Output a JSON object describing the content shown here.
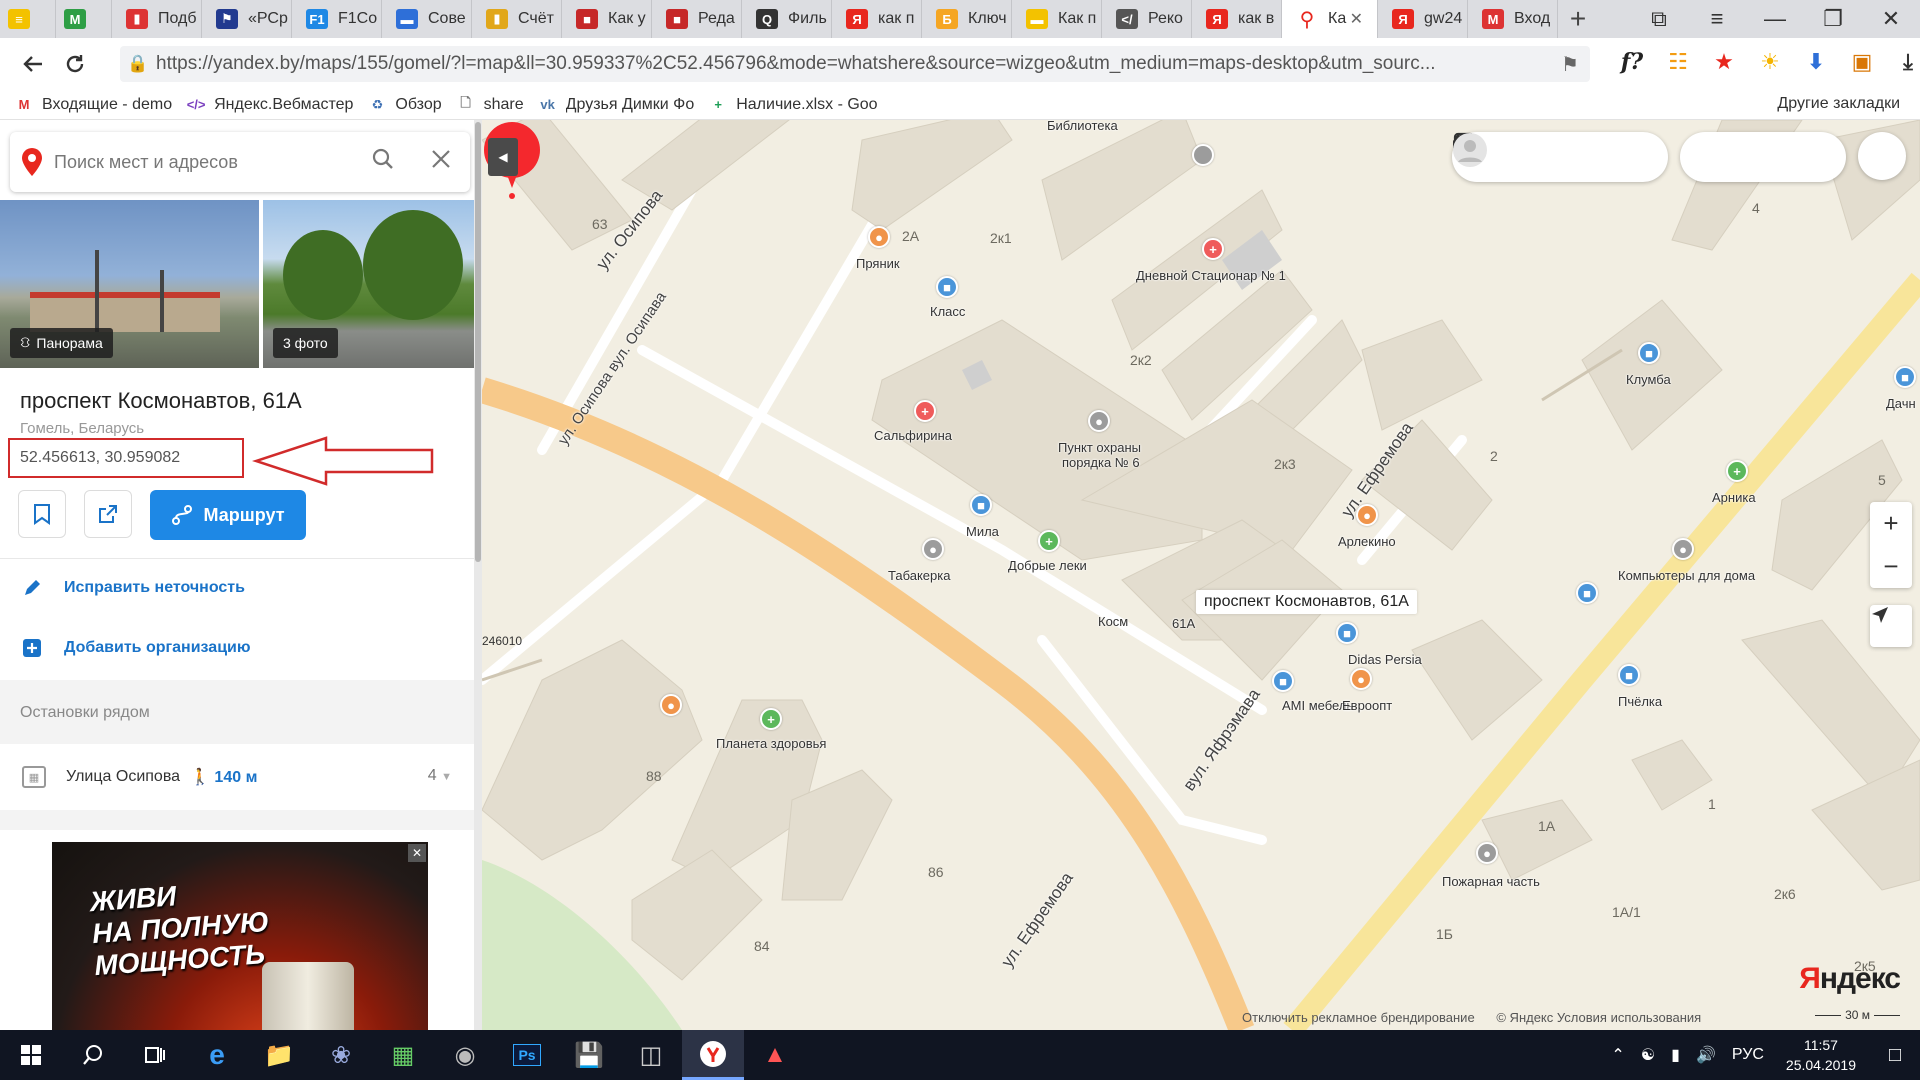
{
  "browser": {
    "tabs": [
      {
        "label": "",
        "icon": "yellow-doc",
        "color": "#f3c200"
      },
      {
        "label": "",
        "icon": "gmail",
        "color": "#2e9e45"
      },
      {
        "label": "Подб",
        "icon": "chart",
        "color": "#d33"
      },
      {
        "label": "«РСр",
        "icon": "flag",
        "color": "#223a8f"
      },
      {
        "label": "F1Co",
        "icon": "f1",
        "color": "#1e88e5"
      },
      {
        "label": "Сове",
        "icon": "disk",
        "color": "#2e6fd8"
      },
      {
        "label": "Счёт",
        "icon": "chart",
        "color": "#e1a71a"
      },
      {
        "label": "Как у",
        "icon": "book",
        "color": "#c62828"
      },
      {
        "label": "Реда",
        "icon": "book",
        "color": "#c62828"
      },
      {
        "label": "Филь",
        "icon": "search",
        "color": "#333"
      },
      {
        "label": "как п",
        "icon": "yandex",
        "color": "#e8271e"
      },
      {
        "label": "Ключ",
        "icon": "b",
        "color": "#f5a623"
      },
      {
        "label": "Как п",
        "icon": "beeline",
        "color": "#f3c200"
      },
      {
        "label": "Реко",
        "icon": "code",
        "color": "#555"
      },
      {
        "label": "как в",
        "icon": "yandex",
        "color": "#e8271e"
      },
      {
        "label": "Ка",
        "icon": "maps-pin",
        "color": "#e8271e"
      },
      {
        "label": "gw24",
        "icon": "yandex",
        "color": "#e8271e"
      },
      {
        "label": "Вход",
        "icon": "gmail",
        "color": "#d33"
      }
    ],
    "address": "https://yandex.by/maps/155/gomel/?l=map&ll=30.959337%2C52.456796&mode=whatshere&source=wizgeo&utm_medium=maps-desktop&utm_sourc...",
    "bookmarks": [
      {
        "label": "Входящие - demo",
        "color": "#d33",
        "glyph": "M"
      },
      {
        "label": "Яндекс.Вебмастер",
        "color": "#7a3fbf",
        "glyph": "</>"
      },
      {
        "label": "Обзор",
        "color": "#3c6fb3",
        "glyph": "♻"
      },
      {
        "label": "share",
        "color": "#777",
        "glyph": "🗋"
      },
      {
        "label": "Друзья Димки Фо",
        "color": "#4a76a8",
        "glyph": "vk"
      },
      {
        "label": "Наличие.xlsx - Goo",
        "color": "#1e9e57",
        "glyph": "+"
      }
    ],
    "bookmarks_other": "Другие закладки"
  },
  "search": {
    "placeholder": "Поиск мест и адресов"
  },
  "photos": {
    "panorama_label": "Панорама",
    "photo_count": "3 фото"
  },
  "place": {
    "title": "проспект Космонавтов, 61А",
    "subtitle": "Гомель, Беларусь",
    "coordinates": "52.456613, 30.959082",
    "route_label": "Маршрут",
    "fix_label": "Исправить неточность",
    "add_org_label": "Добавить организацию"
  },
  "nearby": {
    "title": "Остановки рядом",
    "stop_name": "Улица Осипова",
    "stop_distance": "140 м",
    "stop_routes": "4"
  },
  "ad": {
    "line1": "ЖИВИ",
    "line2": "НА ПОЛНУЮ",
    "line3": "МОЩНОСТЬ"
  },
  "map": {
    "pin_label": "проспект Космонавтов, 61А",
    "places": {
      "biblioteka": "Библиотека",
      "pryanik": "Пряник",
      "klass": "Класс",
      "stacionar": "Дневной Стационар № 1",
      "salfirina": "Сальфирина",
      "punkt": "Пункт охраны",
      "punkt2": "порядка № 6",
      "mila": "Мила",
      "dobrye": "Добрые леки",
      "tabakerka": "Табакерка",
      "arlekino": "Арлекино",
      "didas": "Didas Persia",
      "ami": "AMI мебель",
      "evroopt": "Евроопт",
      "planeta": "Планета здоровья",
      "klumba": "Клумба",
      "arnika": "Арника",
      "kompy": "Компьютеры для дома",
      "pchelka": "Пчёлка",
      "pozhar": "Пожарная часть",
      "dachn": "Дачн",
      "kosm": "Косм",
      "kosm2": "61А"
    },
    "house_numbers": {
      "n63": "63",
      "n2a": "2А",
      "n2k1": "2к1",
      "n2k2": "2к2",
      "n2k3": "2к3",
      "n2": "2",
      "n4": "4",
      "n5": "5",
      "n88": "88",
      "n86": "86",
      "n84": "84",
      "n1": "1",
      "n1a": "1А",
      "n1a1": "1А/1",
      "n1b": "1Б",
      "n2k6": "2к6",
      "n2k5": "2к5",
      "n246010": "246010"
    },
    "streets": {
      "osipova1": "ул. Осипова",
      "osipova2": "ул. Осипова вул. Осипава",
      "efremova1": "ул. Ефремова",
      "efremova2": "вул. Яфрэмава",
      "efremova3": "ул. Ефремова"
    },
    "logo_main": "Я",
    "logo_rest": "ндекс",
    "footer_disable": "Отключить рекламное брендирование",
    "footer_copy": "© Яндекс",
    "footer_terms": "Условия использования",
    "scale_label": "30 м"
  },
  "taskbar": {
    "lang": "РУС",
    "time": "11:57",
    "date": "25.04.2019"
  }
}
